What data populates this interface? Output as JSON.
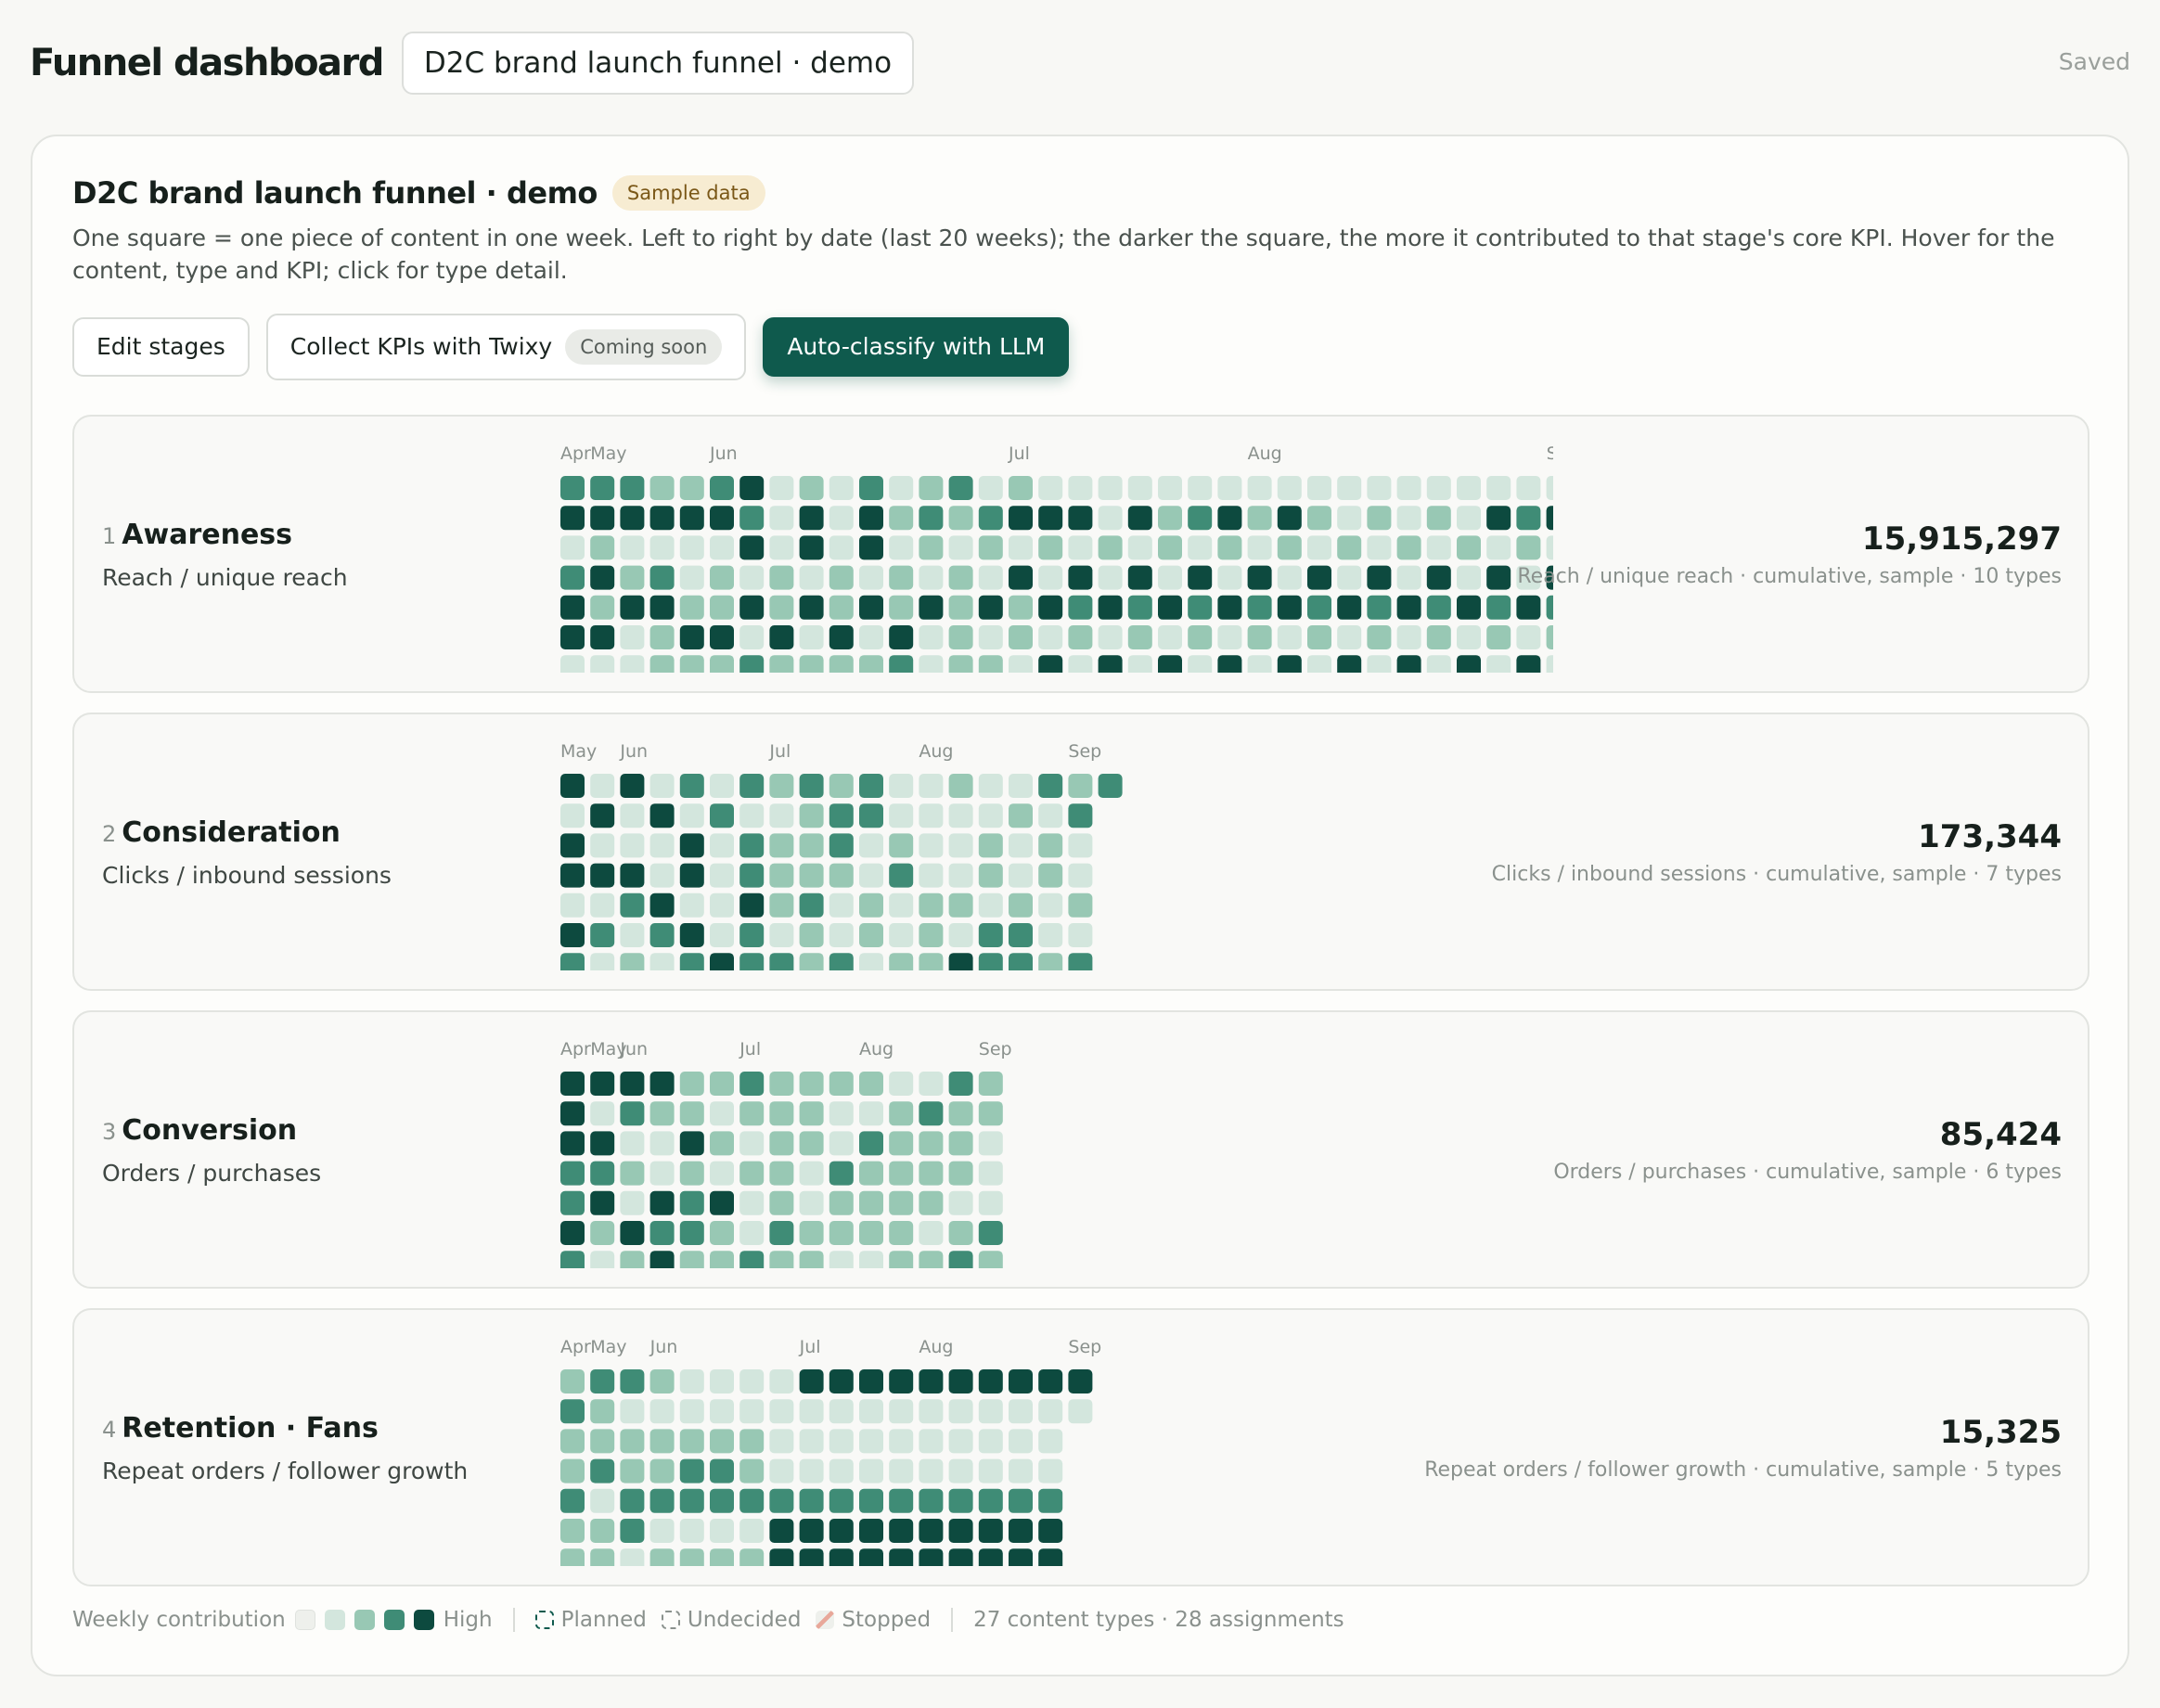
{
  "header": {
    "app_title": "Funnel dashboard",
    "doc_name": "D2C brand launch funnel · demo",
    "status": "Saved"
  },
  "card": {
    "title": "D2C brand launch funnel · demo",
    "badge": "Sample data",
    "description": "One square = one piece of content in one week. Left to right by date (last 20 weeks); the darker the square, the more it contributed to that stage's core KPI. Hover for the content, type and KPI; click for type detail."
  },
  "actions": {
    "edit_stages": "Edit stages",
    "collect_kpis": "Collect KPIs with Twixy",
    "coming_soon": "Coming soon",
    "auto_classify": "Auto-classify with LLM"
  },
  "colors": {
    "level0": "#eef0ec",
    "level1": "#d3e6dd",
    "level2": "#98c8b4",
    "level3": "#3f8c76",
    "level4": "#0d4a3f",
    "accent": "#0f5a4d",
    "planned": "#0f5a4d",
    "stopped": "#e8a89a"
  },
  "stages": [
    {
      "num": "1",
      "name": "Awareness",
      "kpi": "Reach / unique reach",
      "metric": "15,915,297",
      "note": "Reach / unique reach · cumulative, sample · 10 types",
      "month_labels": [
        {
          "label": "Apr",
          "col": 0
        },
        {
          "label": "May",
          "col": 1
        },
        {
          "label": "Jun",
          "col": 5
        },
        {
          "label": "Jul",
          "col": 15
        },
        {
          "label": "Aug",
          "col": 23
        },
        {
          "label": "S",
          "col": 33
        }
      ],
      "rows": [
        "3332234121312312111111111111111111",
        "4444443141423234441423424212121434",
        "1211114141412121212121212121212121",
        "3423121212121214141414141414141414",
        "4244224242424242434343434343434343",
        "4412441414141212121212121212121212",
        "1112223222231221414141414141414141"
      ]
    },
    {
      "num": "2",
      "name": "Consideration",
      "kpi": "Clicks / inbound sessions",
      "metric": "173,344",
      "note": "Clicks / inbound sessions · cumulative, sample · 7 types",
      "month_labels": [
        {
          "label": "May",
          "col": 0
        },
        {
          "label": "Jun",
          "col": 2
        },
        {
          "label": "Jul",
          "col": 7
        },
        {
          "label": "Aug",
          "col": 12
        },
        {
          "label": "Sep",
          "col": 17
        }
      ],
      "rows": [
        "4141313232311211323",
        "141413112331111213",
        "411141322312112121",
        "444141322213112121",
        "113411423121221212",
        "431341312121213311",
        "312134332312243323"
      ]
    },
    {
      "num": "3",
      "name": "Conversion",
      "kpi": "Orders / purchases",
      "metric": "85,424",
      "note": "Orders / purchases · cumulative, sample · 6 types",
      "month_labels": [
        {
          "label": "Apr",
          "col": 0
        },
        {
          "label": "May",
          "col": 1
        },
        {
          "label": "Jun",
          "col": 2
        },
        {
          "label": "Jul",
          "col": 6
        },
        {
          "label": "Aug",
          "col": 10
        },
        {
          "label": "Sep",
          "col": 14
        }
      ],
      "rows": [
        "444422322221132",
        "413221222112322",
        "441142122132221",
        "332121221322221",
        "341434121222211",
        "424332132222123",
        "312422322112232"
      ]
    },
    {
      "num": "4",
      "name": "Retention · Fans",
      "kpi": "Repeat orders / follower growth",
      "metric": "15,325",
      "note": "Repeat orders / follower growth · cumulative, sample · 5 types",
      "month_labels": [
        {
          "label": "Apr",
          "col": 0
        },
        {
          "label": "May",
          "col": 1
        },
        {
          "label": "Jun",
          "col": 3
        },
        {
          "label": "Jul",
          "col": 8
        },
        {
          "label": "Aug",
          "col": 12
        },
        {
          "label": "Sep",
          "col": 17
        }
      ],
      "rows": [
        "233211114444444444",
        "321111111111111111",
        "22222221111111111",
        "23223321111111111",
        "31333333333333333",
        "22311114444444444",
        "22122224444444444"
      ]
    }
  ],
  "legend": {
    "weekly_label": "Weekly contribution",
    "high_label": "High",
    "planned": "Planned",
    "undecided": "Undecided",
    "stopped": "Stopped",
    "summary": "27 content types · 28 assignments"
  }
}
